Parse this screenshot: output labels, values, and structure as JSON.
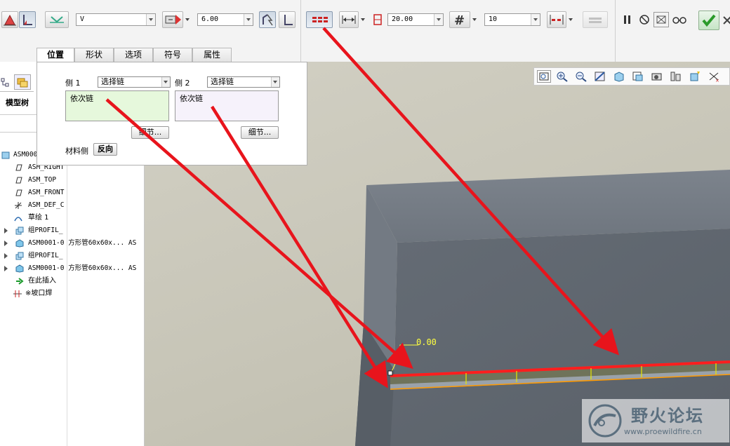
{
  "toolbar": {
    "weld_symbol_value": "V",
    "dimension_value": "6.00",
    "length_value": "20.00",
    "count_value": "10",
    "icons": [
      "fillet-weld-icon",
      "groove-weld-icon",
      "weld-symbol-icon",
      "weld-type-dropdown",
      "size-icon",
      "edge-prep-icon",
      "side-weld-icon",
      "intermittent-icon",
      "length-icon",
      "pitch-icon",
      "hash-count-icon",
      "spacing-icon",
      "pattern-icon",
      "pause-icon",
      "cancel-circle-icon",
      "preview-icon",
      "glasses-icon",
      "confirm-check-icon",
      "close-icon"
    ]
  },
  "tabs": [
    {
      "label": "位置"
    },
    {
      "label": "形状"
    },
    {
      "label": "选项"
    },
    {
      "label": "符号"
    },
    {
      "label": "属性"
    }
  ],
  "panel": {
    "side1_label": "侧 1",
    "side1_select": "选择链",
    "side1_chain": "依次链",
    "side2_label": "侧 2",
    "side2_select": "选择链",
    "side2_chain": "依次链",
    "details_label": "细节...",
    "material_side_label": "材料侧",
    "reverse_label": "反向"
  },
  "leftpane": {
    "model_tree_label": "模型树",
    "rows": [
      {
        "text": "ASM000",
        "kind": "asm"
      },
      {
        "text": "ASM_RIGHT",
        "kind": "plane"
      },
      {
        "text": "ASM_TOP",
        "kind": "plane"
      },
      {
        "text": "ASM_FRONT",
        "kind": "plane"
      },
      {
        "text": "ASM_DEF_C",
        "kind": "csys"
      },
      {
        "text": "草绘 1",
        "kind": "sketch"
      },
      {
        "text": "组PROFIL_",
        "kind": "group"
      },
      {
        "text": "ASM0001-0 方形管60x60x...  AS",
        "kind": "part"
      },
      {
        "text": "组PROFIL_",
        "kind": "group"
      },
      {
        "text": "ASM0001-0 方形管60x60x...  AS",
        "kind": "part"
      },
      {
        "text": "在此插入",
        "kind": "insert"
      },
      {
        "text": "※坡口焊 ",
        "kind": "weld"
      }
    ]
  },
  "viewport": {
    "dimension_label": "0.00",
    "icons": [
      "refit-icon",
      "zoom-in-icon",
      "zoom-out-icon",
      "repaint-icon",
      "display-style-icon",
      "saved-views-icon",
      "layers-icon",
      "view-manager-icon",
      "spin-center-icon",
      "datum-display-icon"
    ]
  },
  "watermark": {
    "title": "野火论坛",
    "url": "www.proewildfire.cn"
  },
  "colors": {
    "arrow": "#e8141c",
    "edge_highlight": "#ff2020",
    "dim_text": "#ffff40",
    "confirm_green": "#3aa53a"
  }
}
